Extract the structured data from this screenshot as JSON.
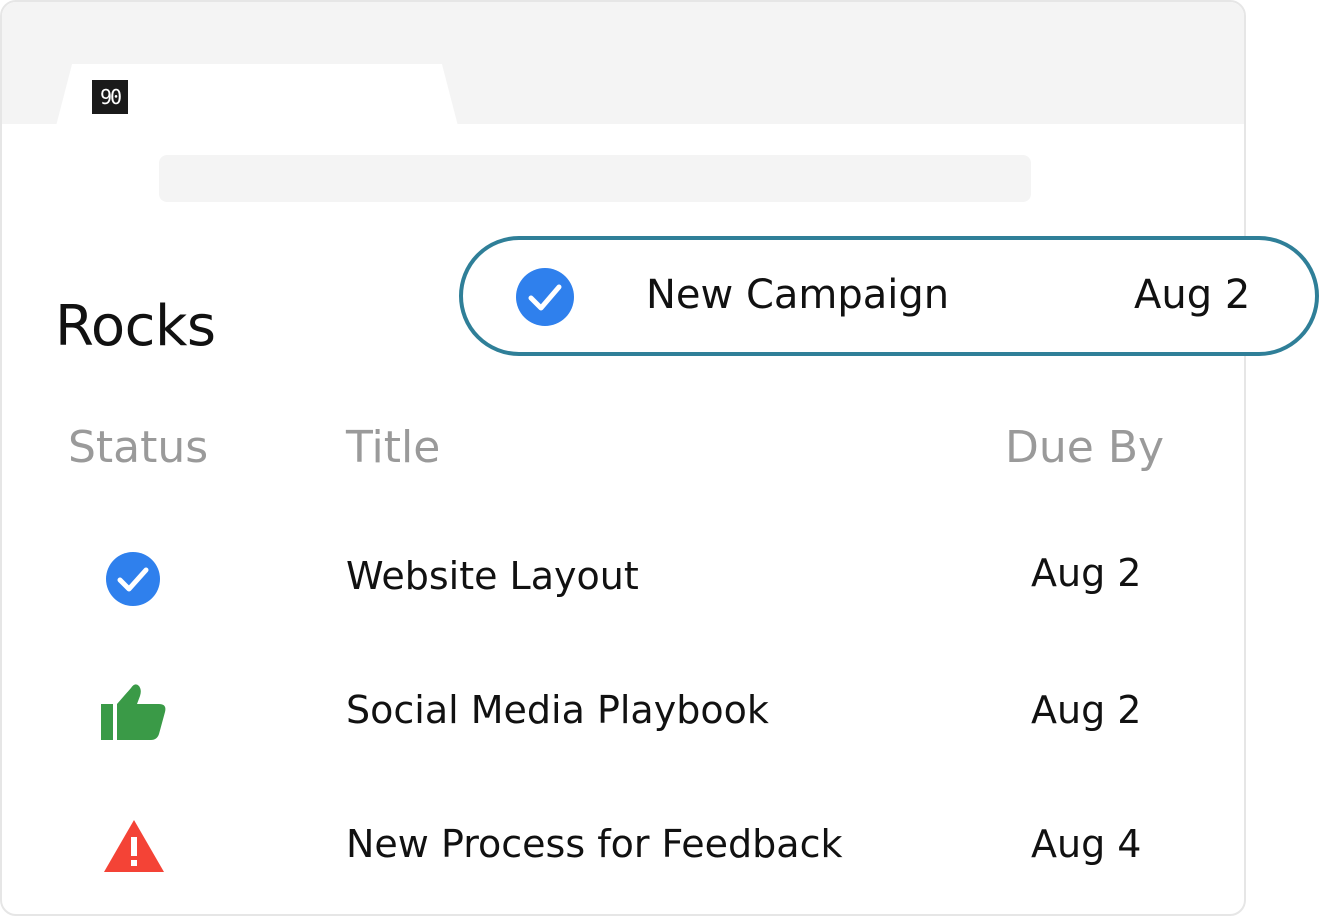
{
  "header": {
    "logo_text": "90"
  },
  "page": {
    "title": "Rocks"
  },
  "table": {
    "headers": {
      "status": "Status",
      "title": "Title",
      "due": "Due By"
    },
    "rows": [
      {
        "status_icon": "check-circle-icon",
        "title": "Website Layout",
        "due": "Aug 2"
      },
      {
        "status_icon": "thumbs-up-icon",
        "title": "Social Media Playbook",
        "due": "Aug 2"
      },
      {
        "status_icon": "warning-triangle-icon",
        "title": "New Process for Feedback",
        "due": "Aug 4"
      }
    ]
  },
  "callout": {
    "status_icon": "check-circle-icon",
    "title": "New Campaign",
    "due": "Aug 2"
  },
  "colors": {
    "blue": "#2f80ed",
    "green": "#3a9a47",
    "red": "#f44336",
    "callout_border": "#2f7f98"
  }
}
